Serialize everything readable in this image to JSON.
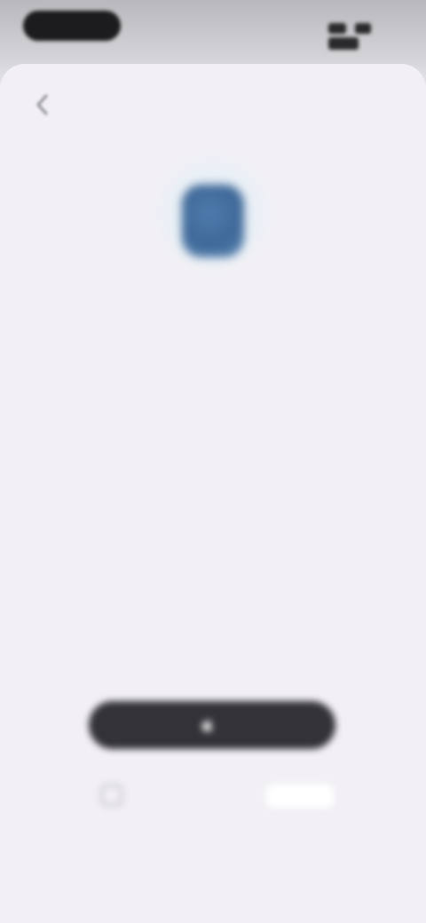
{
  "status_bar": {
    "time": "",
    "icons": [
      "signal-icon",
      "wifi-icon",
      "battery-icon"
    ]
  },
  "nav": {
    "back_icon": "chevron-left-icon",
    "title": ""
  },
  "hero": {
    "icon": "app-icon",
    "accent_color": "#3e6898"
  },
  "headline": "",
  "description": "",
  "primary_button": {
    "icon": "apple-logo-icon",
    "label": "",
    "background": "#333236"
  },
  "consent": {
    "text": "",
    "link": ""
  }
}
